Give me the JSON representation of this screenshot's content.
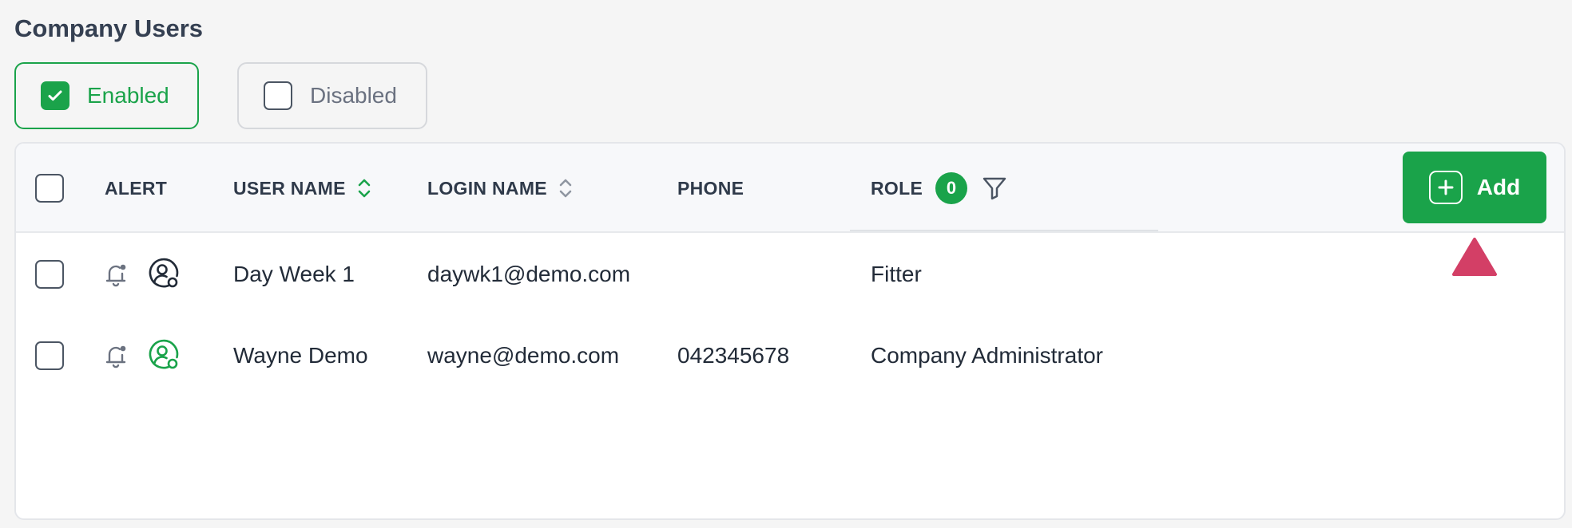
{
  "page": {
    "title": "Company Users"
  },
  "filters": {
    "enabled": {
      "label": "Enabled",
      "checked": true
    },
    "disabled": {
      "label": "Disabled",
      "checked": false
    }
  },
  "table": {
    "columns": {
      "alert": "ALERT",
      "user_name": "USER NAME",
      "login_name": "LOGIN NAME",
      "phone": "PHONE",
      "role": "ROLE"
    },
    "role_filter_count": "0",
    "add_label": "Add",
    "rows": [
      {
        "user_name": "Day Week 1",
        "login_name": "daywk1@demo.com",
        "phone": "",
        "role": "Fitter",
        "user_icon_color": "#222b38"
      },
      {
        "user_name": "Wayne Demo",
        "login_name": "wayne@demo.com",
        "phone": "042345678",
        "role": "Company Administrator",
        "user_icon_color": "#1aa34a"
      }
    ]
  },
  "icons": {
    "check": "check-icon",
    "sort": "sort-icon",
    "filter": "filter-icon",
    "plus": "plus-icon",
    "bell": "bell-icon",
    "user_status": "user-status-icon",
    "warning": "warning-triangle-icon"
  },
  "colors": {
    "accent": "#1aa34a",
    "warning": "#d33f66",
    "title": "#354052"
  }
}
